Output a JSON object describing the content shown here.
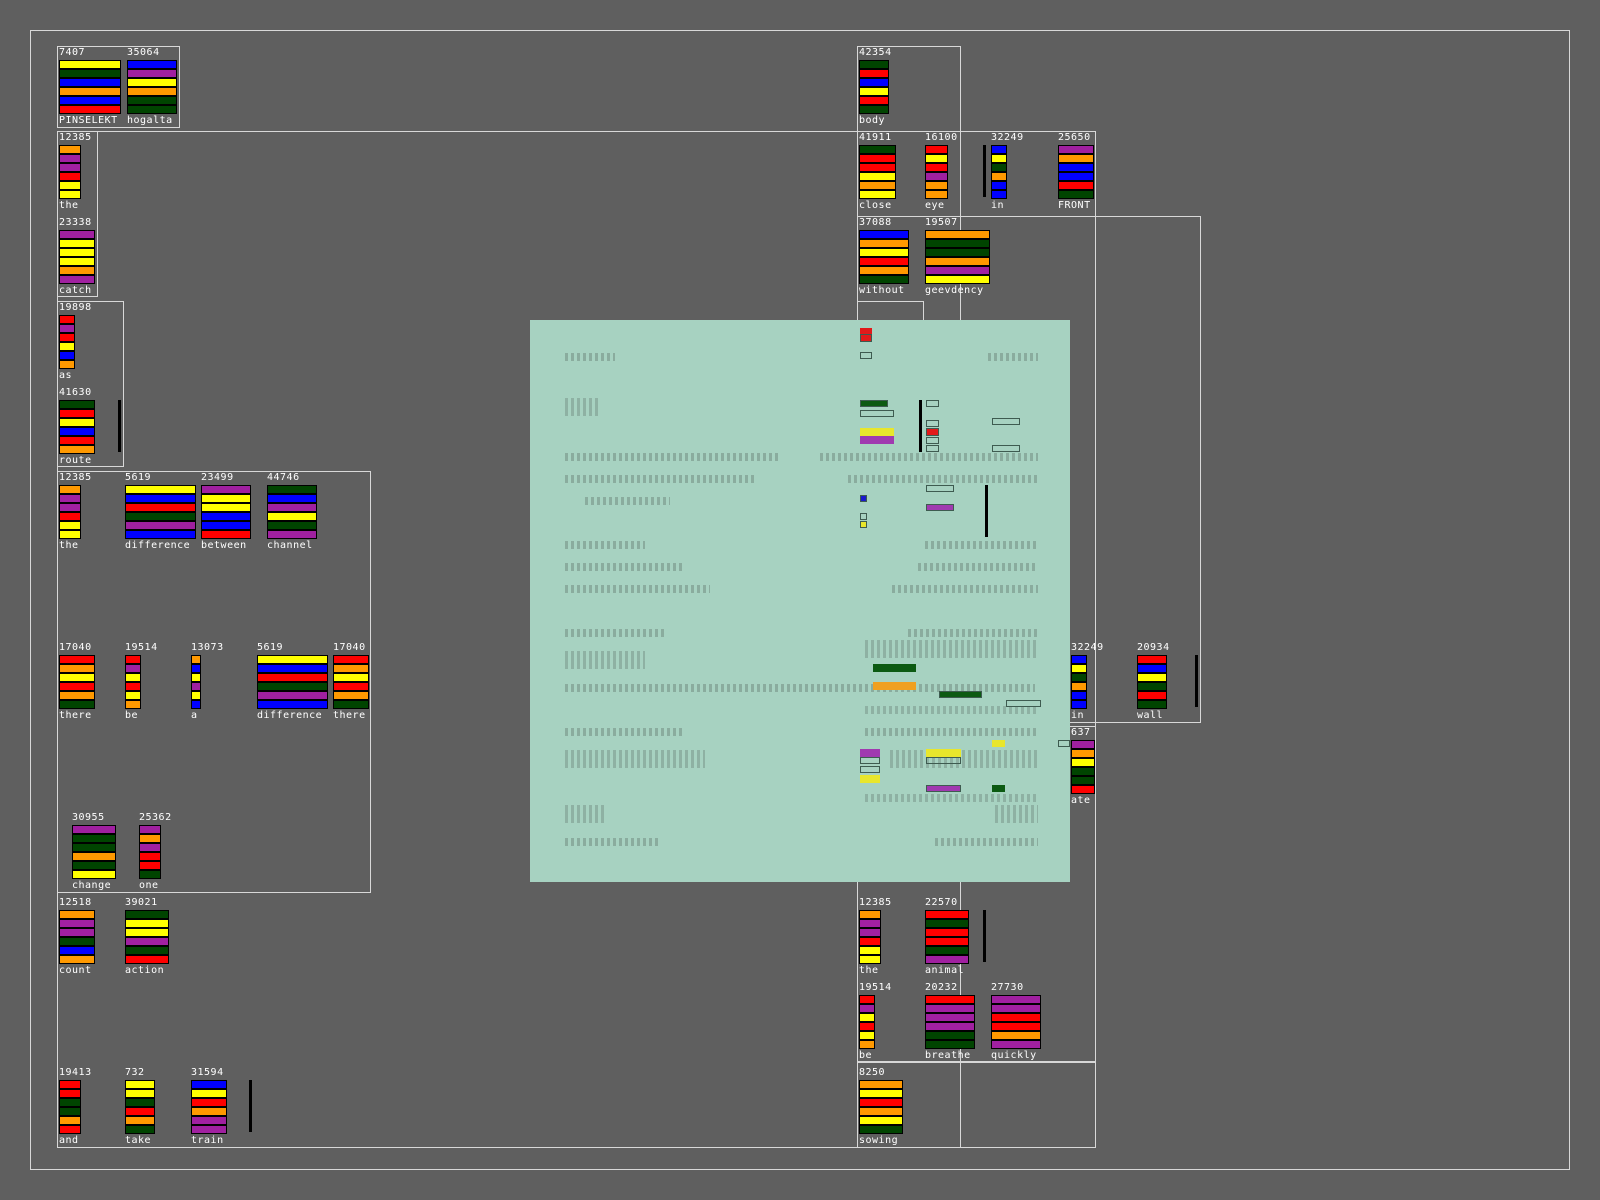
{
  "colors": {
    "yellow": "#ffff00",
    "blue": "#0000ff",
    "orange": "#ff9900",
    "red": "#ff0000",
    "green": "#004400",
    "purple": "#a020a0",
    "white": "#ffffff",
    "background": "#5f5f5f",
    "dialog_bg": "#a7d2c1"
  },
  "words": [
    {
      "id": "pinselekt",
      "number": "7407",
      "label": "PINSELEKT",
      "bars": [
        "yellow",
        "green",
        "blue",
        "orange",
        "blue",
        "red"
      ]
    },
    {
      "id": "hogalta",
      "number": "35064",
      "label": "hogalta",
      "bars": [
        "blue",
        "purple",
        "yellow",
        "orange",
        "green",
        "green"
      ]
    },
    {
      "id": "body",
      "number": "42354",
      "label": "body",
      "bars": [
        "green",
        "red",
        "blue",
        "yellow",
        "red",
        "green"
      ]
    },
    {
      "id": "the-1",
      "number": "12385",
      "label": "the",
      "bars": [
        "orange",
        "purple",
        "purple",
        "red",
        "yellow",
        "yellow"
      ]
    },
    {
      "id": "close",
      "number": "41911",
      "label": "close",
      "bars": [
        "green",
        "red",
        "red",
        "yellow",
        "orange",
        "yellow"
      ]
    },
    {
      "id": "eye",
      "number": "16100",
      "label": "eye",
      "bars": [
        "red",
        "yellow",
        "red",
        "purple",
        "orange",
        "orange"
      ]
    },
    {
      "id": "in-1",
      "number": "32249",
      "label": "in",
      "bars": [
        "blue",
        "yellow",
        "green",
        "orange",
        "blue",
        "blue"
      ]
    },
    {
      "id": "front",
      "number": "25650",
      "label": "FRONT",
      "bars": [
        "purple",
        "orange",
        "blue",
        "blue",
        "red",
        "green"
      ]
    },
    {
      "id": "catch",
      "number": "23338",
      "label": "catch",
      "bars": [
        "purple",
        "yellow",
        "yellow",
        "yellow",
        "orange",
        "purple"
      ]
    },
    {
      "id": "without",
      "number": "37088",
      "label": "without",
      "bars": [
        "blue",
        "orange",
        "yellow",
        "red",
        "orange",
        "green"
      ]
    },
    {
      "id": "geevdency",
      "number": "19507",
      "label": "geevdency",
      "bars": [
        "orange",
        "green",
        "green",
        "orange",
        "purple",
        "yellow"
      ]
    },
    {
      "id": "as",
      "number": "19898",
      "label": "as",
      "bars": [
        "red",
        "purple",
        "red",
        "yellow",
        "blue",
        "orange"
      ]
    },
    {
      "id": "route",
      "number": "41630",
      "label": "route",
      "bars": [
        "green",
        "red",
        "yellow",
        "blue",
        "red",
        "orange"
      ]
    },
    {
      "id": "the-2",
      "number": "12385",
      "label": "the",
      "bars": [
        "orange",
        "purple",
        "purple",
        "red",
        "yellow",
        "yellow"
      ]
    },
    {
      "id": "difference-1",
      "number": "5619",
      "label": "difference",
      "bars": [
        "yellow",
        "blue",
        "red",
        "green",
        "purple",
        "blue"
      ]
    },
    {
      "id": "between",
      "number": "23499",
      "label": "between",
      "bars": [
        "purple",
        "yellow",
        "yellow",
        "blue",
        "blue",
        "red"
      ]
    },
    {
      "id": "channel",
      "number": "44746",
      "label": "channel",
      "bars": [
        "green",
        "blue",
        "purple",
        "yellow",
        "green",
        "purple"
      ]
    },
    {
      "id": "there-1",
      "number": "17040",
      "label": "there",
      "bars": [
        "red",
        "orange",
        "yellow",
        "red",
        "orange",
        "green"
      ]
    },
    {
      "id": "be-1",
      "number": "19514",
      "label": "be",
      "bars": [
        "red",
        "purple",
        "yellow",
        "red",
        "yellow",
        "orange"
      ]
    },
    {
      "id": "a",
      "number": "13073",
      "label": "a",
      "bars": [
        "orange",
        "blue",
        "yellow",
        "purple",
        "yellow",
        "blue"
      ]
    },
    {
      "id": "difference-2",
      "number": "5619",
      "label": "difference",
      "bars": [
        "yellow",
        "blue",
        "red",
        "green",
        "purple",
        "blue"
      ]
    },
    {
      "id": "there-2",
      "number": "17040",
      "label": "there",
      "bars": [
        "red",
        "orange",
        "yellow",
        "red",
        "orange",
        "green"
      ]
    },
    {
      "id": "in-2",
      "number": "32249",
      "label": "in",
      "bars": [
        "blue",
        "yellow",
        "green",
        "orange",
        "blue",
        "blue"
      ]
    },
    {
      "id": "wall",
      "number": "20934",
      "label": "wall",
      "bars": [
        "red",
        "blue",
        "yellow",
        "green",
        "red",
        "green"
      ]
    },
    {
      "id": "state",
      "number": "637",
      "label": "ate",
      "bars": [
        "purple",
        "orange",
        "yellow",
        "green",
        "green",
        "red"
      ]
    },
    {
      "id": "change",
      "number": "30955",
      "label": "change",
      "bars": [
        "purple",
        "green",
        "green",
        "orange",
        "green",
        "yellow"
      ]
    },
    {
      "id": "one",
      "number": "25362",
      "label": "one",
      "bars": [
        "purple",
        "orange",
        "purple",
        "red",
        "red",
        "green"
      ]
    },
    {
      "id": "count",
      "number": "12518",
      "label": "count",
      "bars": [
        "orange",
        "purple",
        "purple",
        "green",
        "blue",
        "orange"
      ]
    },
    {
      "id": "action",
      "number": "39021",
      "label": "action",
      "bars": [
        "green",
        "yellow",
        "yellow",
        "purple",
        "green",
        "red"
      ]
    },
    {
      "id": "the-3",
      "number": "12385",
      "label": "the",
      "bars": [
        "orange",
        "purple",
        "purple",
        "red",
        "yellow",
        "yellow"
      ]
    },
    {
      "id": "animal",
      "number": "22570",
      "label": "animal",
      "bars": [
        "red",
        "green",
        "red",
        "red",
        "green",
        "purple"
      ]
    },
    {
      "id": "be-2",
      "number": "19514",
      "label": "be",
      "bars": [
        "red",
        "purple",
        "yellow",
        "red",
        "yellow",
        "orange"
      ]
    },
    {
      "id": "breathe",
      "number": "20232",
      "label": "breathe",
      "bars": [
        "red",
        "purple",
        "purple",
        "purple",
        "green",
        "green"
      ]
    },
    {
      "id": "quickly",
      "number": "27730",
      "label": "quickly",
      "bars": [
        "purple",
        "purple",
        "red",
        "red",
        "orange",
        "purple"
      ]
    },
    {
      "id": "and",
      "number": "19413",
      "label": "and",
      "bars": [
        "red",
        "red",
        "green",
        "green",
        "orange",
        "red"
      ]
    },
    {
      "id": "take",
      "number": "732",
      "label": "take",
      "bars": [
        "yellow",
        "yellow",
        "green",
        "red",
        "orange",
        "green"
      ]
    },
    {
      "id": "train",
      "number": "31594",
      "label": "train",
      "bars": [
        "blue",
        "yellow",
        "red",
        "orange",
        "purple",
        "purple"
      ]
    },
    {
      "id": "sowing",
      "number": "8250",
      "label": "sowing",
      "bars": [
        "orange",
        "yellow",
        "red",
        "orange",
        "yellow",
        "green"
      ]
    }
  ]
}
